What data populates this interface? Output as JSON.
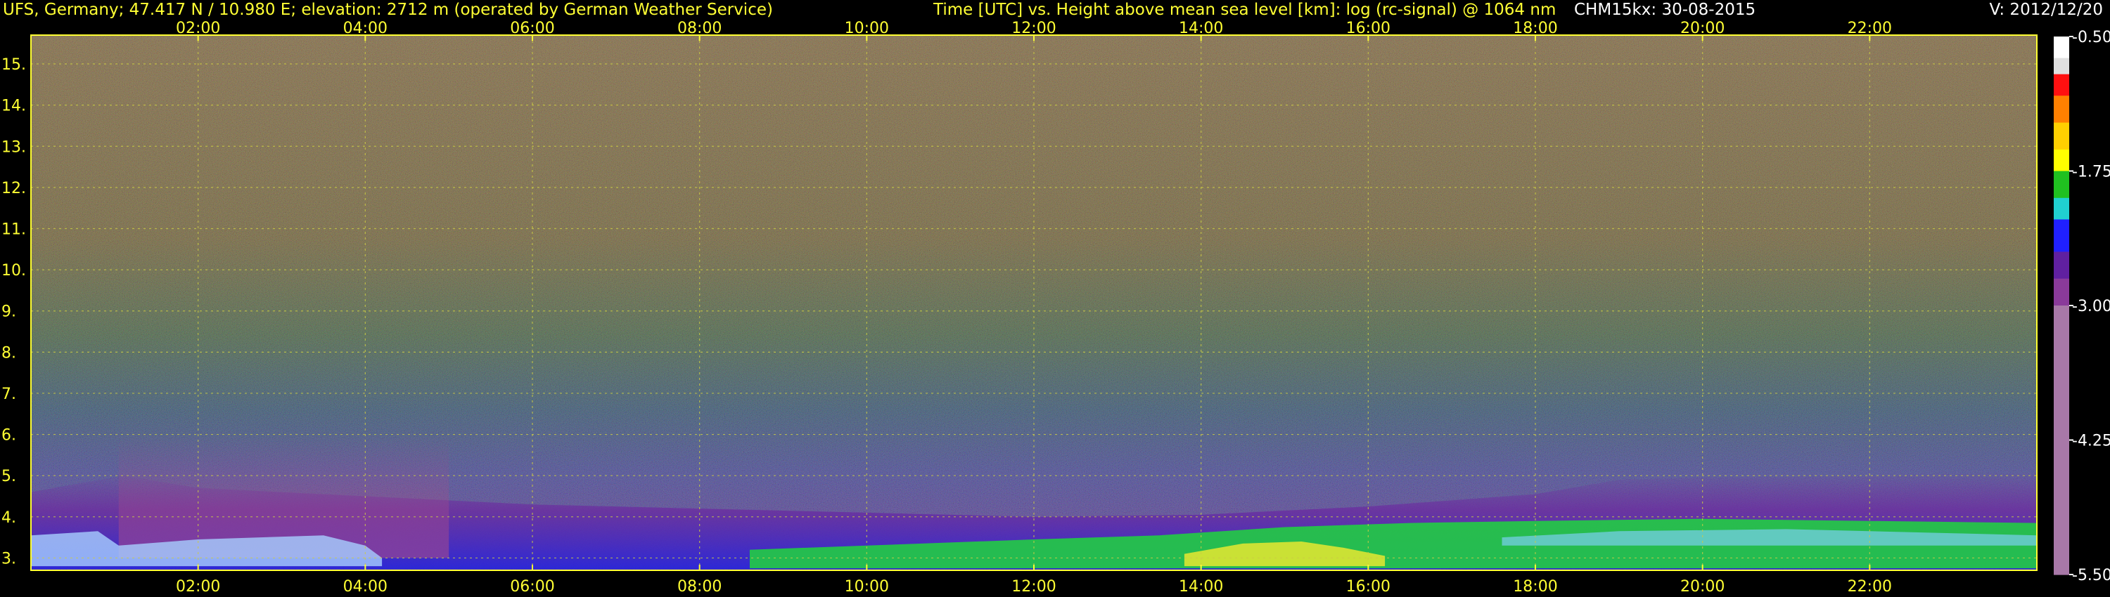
{
  "header": {
    "station": "UFS, Germany; 47.417 N / 10.980 E; elevation: 2712 m  (operated by German Weather Service)",
    "plot_title": "Time [UTC] vs. Height above mean sea level [km]: log (rc-signal) @ 1064 nm",
    "instrument": "CHM15kx: 30-08-2015",
    "version": "V: 2012/12/20"
  },
  "colors": {
    "header_station": "#ffff33",
    "header_title": "#ffff33",
    "header_meta": "#ffffff",
    "axis": "#ffff33",
    "grid": "#cccc44"
  },
  "chart_data": {
    "type": "heatmap",
    "title": "Time [UTC] vs. Height above mean sea level [km]: log (rc-signal) @ 1064 nm",
    "xlabel": "Time [UTC]",
    "ylabel": "Height above mean sea level [km]",
    "xlim": [
      0,
      24
    ],
    "ylim": [
      2.7,
      15.7
    ],
    "x_ticks": [
      2,
      4,
      6,
      8,
      10,
      12,
      14,
      16,
      18,
      20,
      22
    ],
    "x_tick_labels": [
      "02:00",
      "04:00",
      "06:00",
      "08:00",
      "10:00",
      "12:00",
      "14:00",
      "16:00",
      "18:00",
      "20:00",
      "22:00"
    ],
    "y_ticks": [
      3,
      4,
      5,
      6,
      7,
      8,
      9,
      10,
      11,
      12,
      13,
      14,
      15
    ],
    "y_tick_labels": [
      "3.",
      "4.",
      "5.",
      "6.",
      "7.",
      "8.",
      "9.",
      "10.",
      "11.",
      "12.",
      "13.",
      "14.",
      "15."
    ],
    "grid": true,
    "colorbar": {
      "min": -5.5,
      "max": -0.5,
      "ticks": [
        -0.5,
        -1.75,
        -3.0,
        -4.25,
        -5.5
      ],
      "tick_labels": [
        "-0.50",
        "-1.75",
        "-3.00",
        "-4.25",
        "-5.50"
      ],
      "stops": [
        {
          "value": -0.5,
          "color": "#ffffff"
        },
        {
          "value": -0.7,
          "color": "#e0e0e0"
        },
        {
          "value": -0.85,
          "color": "#ff1010"
        },
        {
          "value": -1.05,
          "color": "#ff8000"
        },
        {
          "value": -1.3,
          "color": "#ffd000"
        },
        {
          "value": -1.55,
          "color": "#ffff00"
        },
        {
          "value": -1.75,
          "color": "#20c020"
        },
        {
          "value": -2.0,
          "color": "#20d0d0"
        },
        {
          "value": -2.2,
          "color": "#2020ff"
        },
        {
          "value": -2.5,
          "color": "#6020a0"
        },
        {
          "value": -2.75,
          "color": "#8a3a9a"
        },
        {
          "value": -3.0,
          "color": "#a878a8"
        },
        {
          "value": -5.5,
          "color": "#b088b0"
        }
      ]
    }
  }
}
